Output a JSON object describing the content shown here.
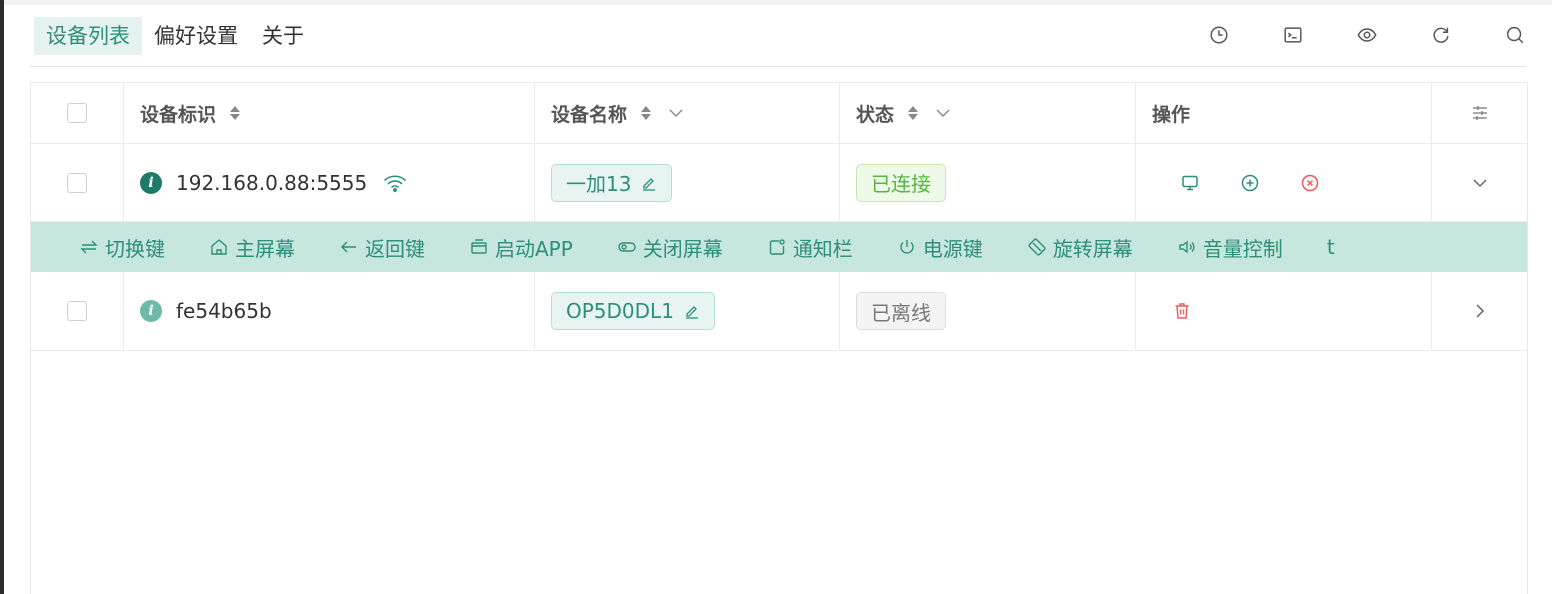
{
  "nav": {
    "items": [
      {
        "label": "设备列表",
        "active": true
      },
      {
        "label": "偏好设置",
        "active": false
      },
      {
        "label": "关于",
        "active": false
      }
    ]
  },
  "toolbar": {
    "icons": [
      "history-icon",
      "terminal-icon",
      "eye-icon",
      "refresh-icon",
      "search-icon"
    ]
  },
  "table": {
    "columns": {
      "device_id": "设备标识",
      "device_name": "设备名称",
      "status": "状态",
      "actions": "操作"
    },
    "rows": [
      {
        "device_id": "192.168.0.88:5555",
        "device_name": "一加13",
        "status": "已连接",
        "status_kind": "connected",
        "wireless": true,
        "expanded": true
      },
      {
        "device_id": "fe54b65b",
        "device_name": "OP5D0DL1",
        "status": "已离线",
        "status_kind": "offline",
        "wireless": false,
        "expanded": false
      }
    ]
  },
  "action_bar": {
    "items": [
      {
        "label": "切换键",
        "icon": "switch-icon"
      },
      {
        "label": "主屏幕",
        "icon": "home-icon"
      },
      {
        "label": "返回键",
        "icon": "back-arrow-icon"
      },
      {
        "label": "启动APP",
        "icon": "app-window-icon"
      },
      {
        "label": "关闭屏幕",
        "icon": "screen-toggle-icon"
      },
      {
        "label": "通知栏",
        "icon": "notification-icon"
      },
      {
        "label": "电源键",
        "icon": "power-icon"
      },
      {
        "label": "旋转屏幕",
        "icon": "rotate-icon"
      },
      {
        "label": "音量控制",
        "icon": "volume-icon"
      }
    ],
    "overflow_glyph": "t"
  },
  "colors": {
    "accent": "#2d8f79",
    "action_bar_bg": "#c7e6de",
    "connected": "#52b73a",
    "danger": "#f05a5a"
  }
}
